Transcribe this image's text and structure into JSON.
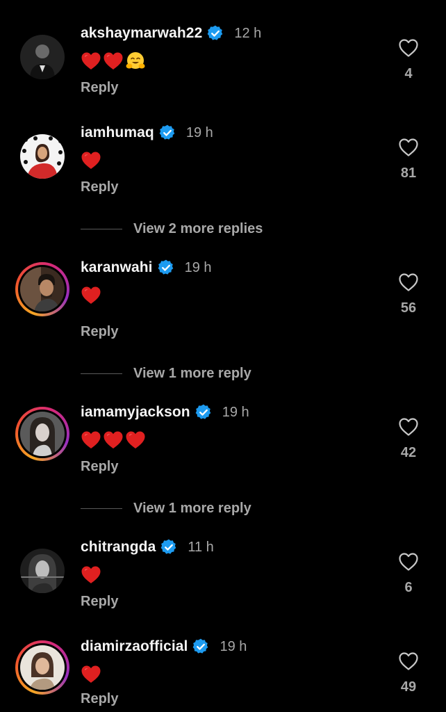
{
  "comments": [
    {
      "username": "akshaymarwah22",
      "time": "12 h",
      "emojis": [
        "heart",
        "heart",
        "hug"
      ],
      "reply": "Reply",
      "likes": "4"
    },
    {
      "username": "iamhumaq",
      "time": "19 h",
      "emojis": [
        "heart"
      ],
      "reply": "Reply",
      "likes": "81"
    },
    {
      "username": "karanwahi",
      "time": "19 h",
      "emojis": [
        "heart"
      ],
      "reply": "Reply",
      "likes": "56"
    },
    {
      "username": "iamamyjackson",
      "time": "19 h",
      "emojis": [
        "heart",
        "heart",
        "heart"
      ],
      "reply": "Reply",
      "likes": "42"
    },
    {
      "username": "chitrangda",
      "time": "11 h",
      "emojis": [
        "heart"
      ],
      "reply": "Reply",
      "likes": "6"
    },
    {
      "username": "diamirzaofficial",
      "time": "19 h",
      "emojis": [
        "heart"
      ],
      "reply": "Reply",
      "likes": "49"
    }
  ],
  "more_replies": [
    {
      "label": "View 2 more replies"
    },
    {
      "label": "View 1 more reply"
    },
    {
      "label": "View 1 more reply"
    }
  ],
  "colors": {
    "background": "#000000",
    "verified": "#1d9bf0",
    "secondary_text": "#a8a8a8",
    "heart": "#e02020"
  }
}
